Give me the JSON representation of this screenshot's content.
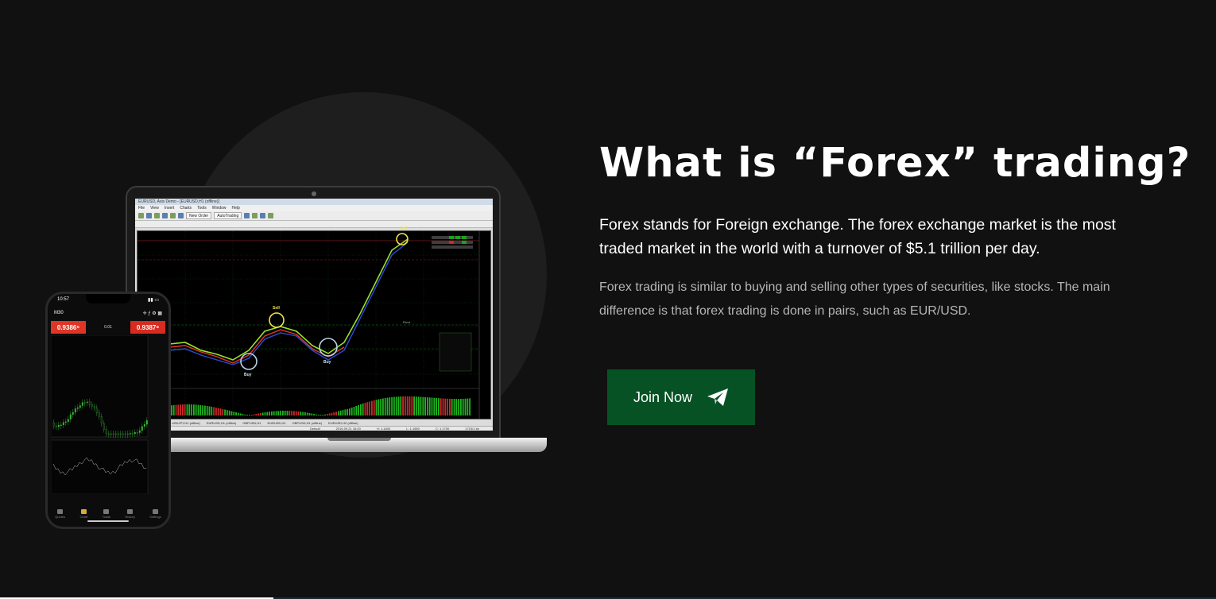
{
  "section": {
    "heading": "What is “Forex” trading?",
    "lead": "Forex stands for Foreign exchange. The forex exchange market is the most traded market in the world with a turnover of $5.1 trillion per day.",
    "description": "Forex trading is similar to buying and selling other types of securities, like stocks. The main difference is that forex trading is done in pairs, such as EUR/USD.",
    "cta_label": "Join Now",
    "cta_icon": "paper-plane-icon",
    "button_color": "#075225"
  },
  "laptop": {
    "window_title": "EURUSD, Axis Demo - [EURUSD,H1 (offline)]",
    "menu": [
      "File",
      "View",
      "Insert",
      "Charts",
      "Tools",
      "Window",
      "Help"
    ],
    "toolbar_new_order": "New Order",
    "toolbar_autotrading": "AutoTrading",
    "labels": {
      "sell": "Sell",
      "buy": "Buy",
      "signal": "Sell",
      "pivot": "Pivot"
    },
    "tabs": [
      "USDJPY,H1 (offline)",
      "EURUSD,H1 (offline)",
      "GBPUSD,H1",
      "EURUSD,H1",
      "GBPUSD,H1 (offline)",
      "EURUSD,H2 (offline)"
    ],
    "status": [
      "Default",
      "2016.09.21 16:00",
      "H: 1.1800",
      "L: 1.1650",
      "C: 1.1700",
      "1715/1 kb"
    ]
  },
  "phone": {
    "time": "10:57",
    "timeframe": "M30",
    "sell_price": "0.9386⁵",
    "buy_price": "0.9387⁸",
    "lot": "0.01",
    "nav": [
      "Quotes",
      "Chart",
      "Trade",
      "History",
      "Settings"
    ]
  }
}
